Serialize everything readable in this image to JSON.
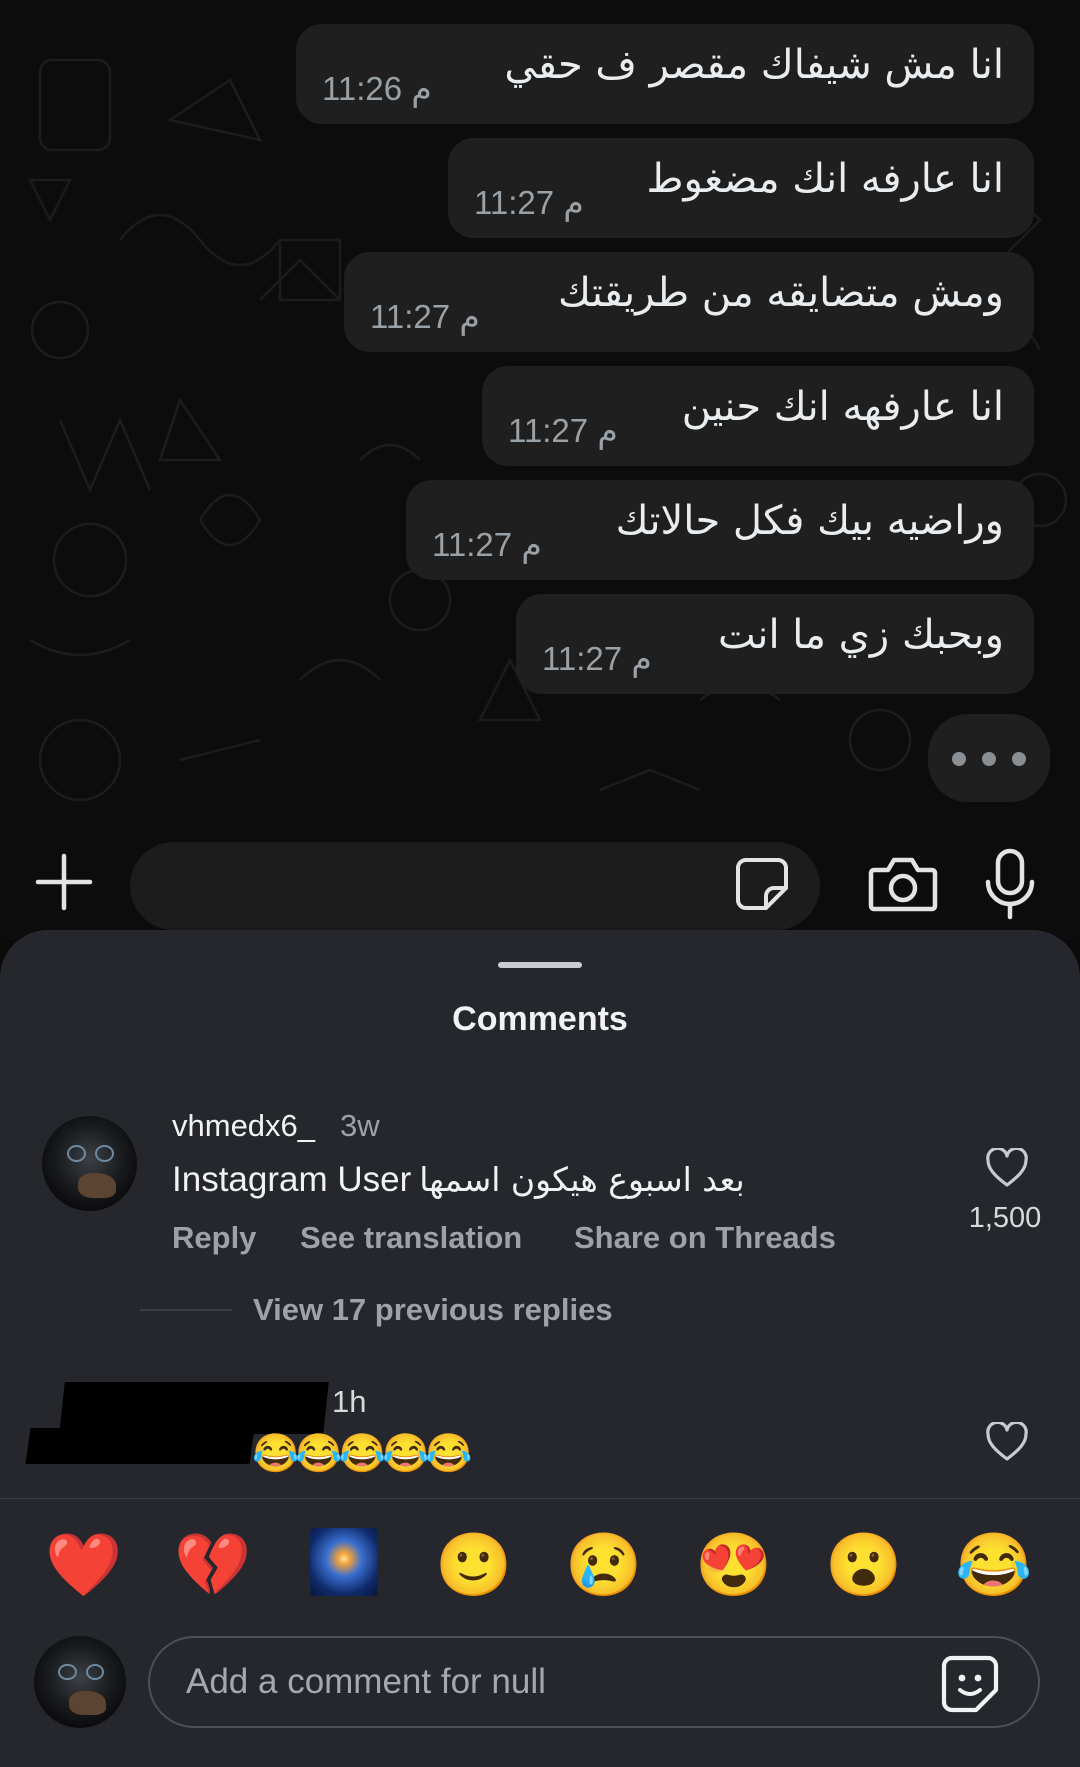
{
  "chat": {
    "messages": [
      {
        "text": "انا مش شيفاك مقصر ف حقي",
        "time": "11:26 م"
      },
      {
        "text": "انا عارفه انك مضغوط",
        "time": "11:27 م"
      },
      {
        "text": "ومش متضايقه من طريقتك",
        "time": "11:27 م"
      },
      {
        "text": "انا عارفهه انك حنين",
        "time": "11:27 م"
      },
      {
        "text": "وراضيه بيك فكل حالاتك",
        "time": "11:27 م"
      },
      {
        "text": "وبحبك زي ما انت",
        "time": "11:27 م"
      }
    ]
  },
  "sheet": {
    "title": "Comments",
    "comment": {
      "username": "vhmedx6_",
      "age": "3w",
      "text": "Instagram User",
      "text_ar": "بعد اسبوع هيكون اسمها",
      "actions": {
        "reply": "Reply",
        "translate": "See translation",
        "threads": "Share on Threads"
      },
      "likes": "1,500"
    },
    "view_replies": "View 17 previous replies",
    "reply": {
      "age": "1h",
      "text": "😂😂😂😂😂"
    },
    "quick_reactions": [
      "❤️",
      "💔",
      "🎆",
      "🙂",
      "😢",
      "😍",
      "😮",
      "😂"
    ],
    "input": {
      "placeholder": "Add a comment for null"
    }
  },
  "icons": {
    "composer": [
      "plus-icon",
      "sticker-icon",
      "camera-icon",
      "microphone-icon"
    ],
    "sheet": [
      "heart-icon",
      "gif-sticker-icon"
    ]
  }
}
